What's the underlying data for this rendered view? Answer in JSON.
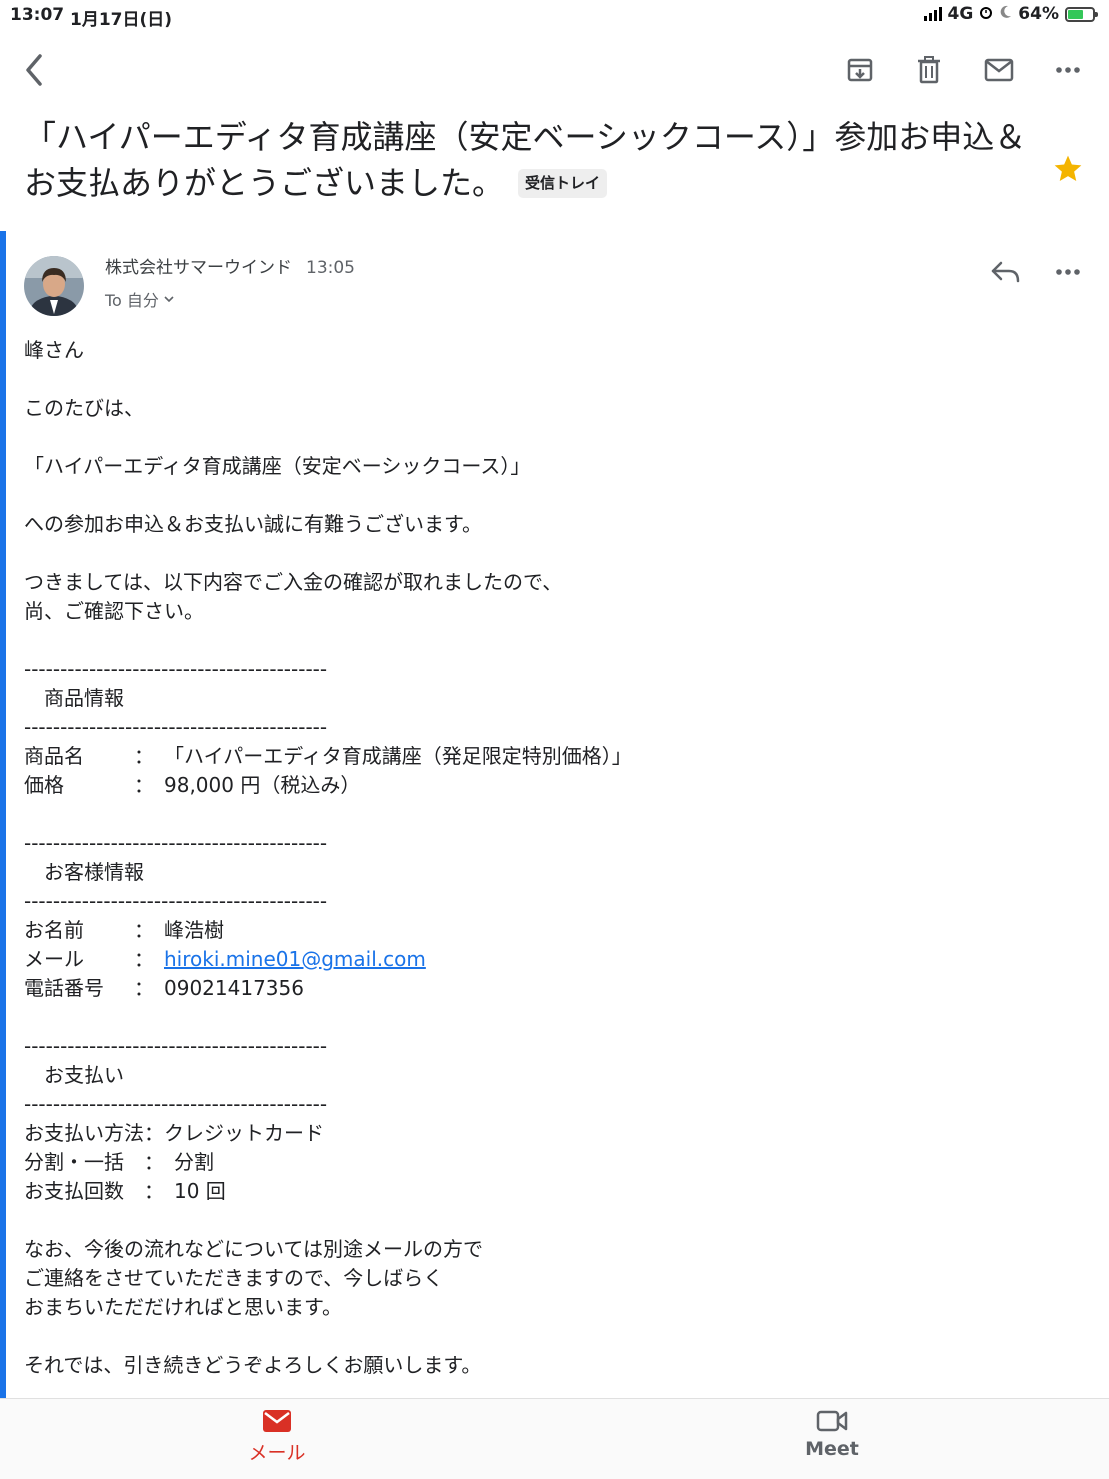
{
  "status_bar": {
    "time": "13:07",
    "date": "1月17日(日)",
    "network": "4G",
    "battery": "64%",
    "battery_level": 0.64
  },
  "toolbar": {
    "back_icon": "chevron-left-icon",
    "archive_icon": "archive-icon",
    "delete_icon": "trash-icon",
    "mark_unread_icon": "mail-icon",
    "more_icon": "more-horiz-icon"
  },
  "subject": {
    "line1": "「ハイパーエディタ育成講座（安定ベーシックコース）」参加お申込＆",
    "line2": "お支払ありがとうございました。",
    "label": "受信トレイ",
    "starred": true,
    "star_color": "#f4b400"
  },
  "message": {
    "sender": "株式会社サマーウインド",
    "time": "13:05",
    "recipient": "To 自分",
    "accent": "#1a73e8",
    "body": {
      "greeting": "峰さん",
      "intro": "このたびは、",
      "course": "「ハイパーエディタ育成講座（安定ベーシックコース）」",
      "thanks": "への参加お申込＆お支払い誠に有難うございます。",
      "confirm1": "つきましては、以下内容でご入金の確認が取れましたので、",
      "confirm2": "尚、ご確認下さい。",
      "divider": "------------------------------------------",
      "product_heading": "　商品情報",
      "product_name_key": "商品名",
      "product_name_sep": "：",
      "product_name_val": "「ハイパーエディタ育成講座（発足限定特別価格）」",
      "price_key": "価格",
      "price_sep": "：",
      "price_val": "98,000 円（税込み）",
      "customer_heading": "　お客様情報",
      "name_key": "お名前",
      "name_sep": "：",
      "name_val": "峰浩樹",
      "email_key": "メール",
      "email_sep": "：",
      "email_val": "hiroki.mine01@gmail.com",
      "phone_key": "電話番号",
      "phone_sep": "：",
      "phone_val": "09021417356",
      "payment_heading": "　お支払い",
      "method_key": "お支払い方法：",
      "method_val": "クレジットカード",
      "split_key": "分割・一括",
      "split_sep": "：",
      "split_val": "分割",
      "count_key": "お支払回数",
      "count_sep": "：",
      "count_val": "10 回",
      "closing1": "なお、今後の流れなどについては別途メールの方で",
      "closing2": "ご連絡をさせていただきますので、今しばらく",
      "closing3": "おまちいただだければと思います。",
      "closing4": "それでは、引き続きどうぞよろしくお願いします。"
    }
  },
  "bottom_nav": {
    "mail_label": "メール",
    "meet_label": "Meet",
    "mail_color": "#d93025"
  }
}
